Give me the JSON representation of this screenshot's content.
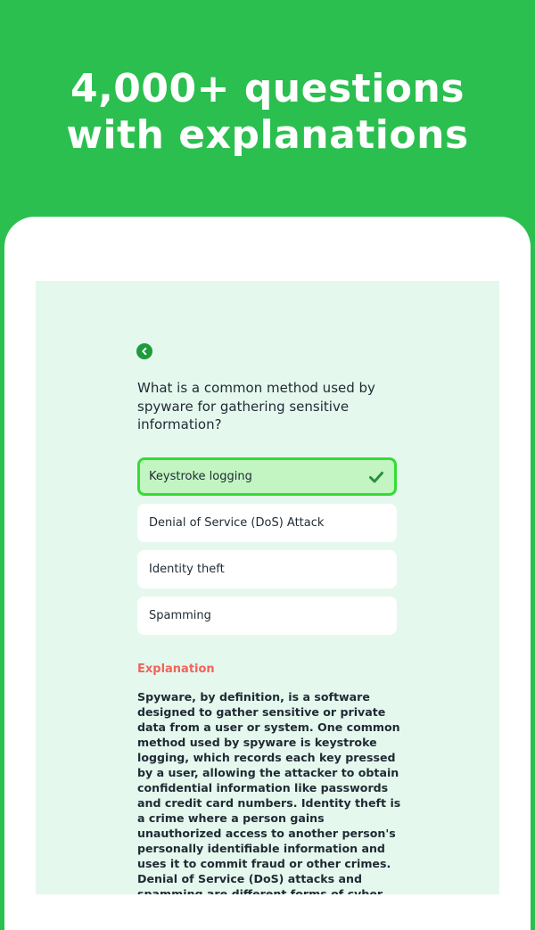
{
  "headline": {
    "line1": "4,000+ questions",
    "line2": "with explanations"
  },
  "quiz": {
    "question": "What is a common method used by spyware for gathering sensitive information?",
    "options": [
      {
        "label": "Keystroke logging",
        "state": "correct"
      },
      {
        "label": "Denial of Service (DoS) Attack",
        "state": "default"
      },
      {
        "label": "Identity theft",
        "state": "default"
      },
      {
        "label": "Spamming",
        "state": "default"
      }
    ],
    "explanation_heading": "Explanation",
    "explanation_text": "Spyware, by definition, is a software designed to gather sensitive or private data from a user or system. One common method used by spyware is keystroke logging, which records each key pressed by a user, allowing the attacker to obtain confidential information like passwords and credit card numbers. Identity theft is a crime where a person gains unauthorized access to another person's personally identifiable information and uses it to commit fraud or other crimes. Denial of Service (DoS) attacks and spamming are different forms of cyber"
  },
  "icons": {
    "back": "chevron-left-circle-icon",
    "correct": "checkmark-icon"
  },
  "colors": {
    "brand_green": "#2bbf4f",
    "screen_background": "#e5f8ee",
    "correct_fill": "#c2f5c2",
    "correct_border": "#33dd33",
    "explanation_heading": "#f0645a"
  }
}
